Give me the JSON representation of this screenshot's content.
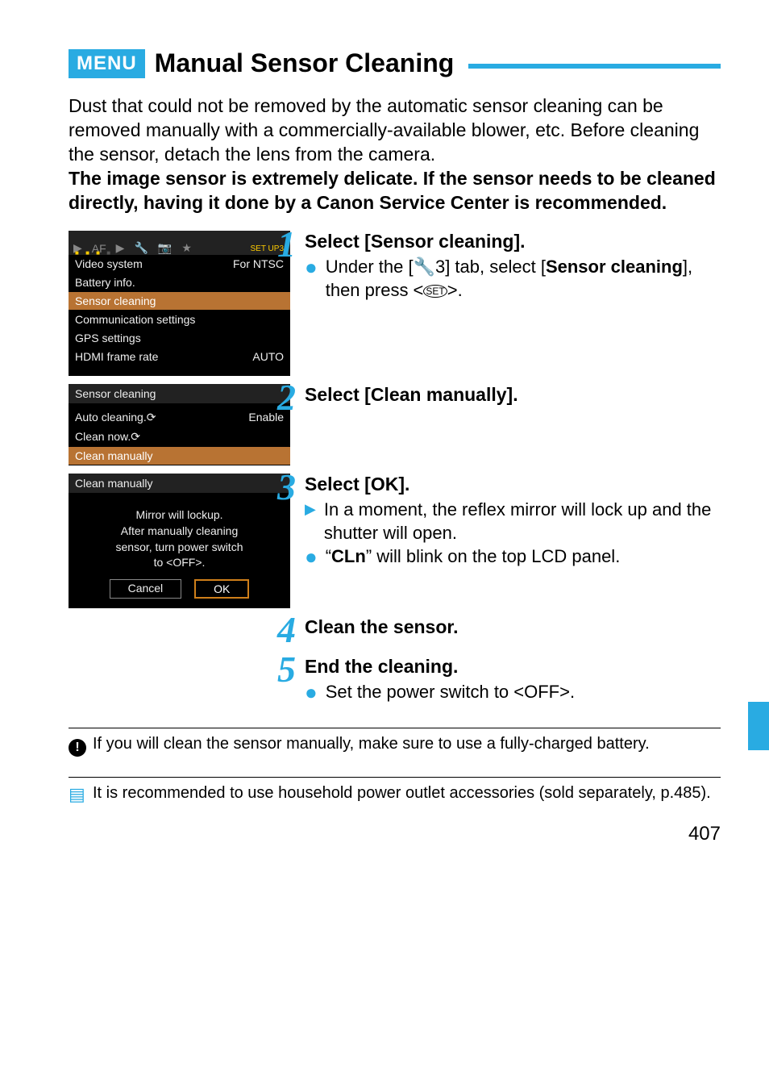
{
  "header": {
    "menu_badge": "MENU",
    "title": "Manual Sensor Cleaning"
  },
  "intro": {
    "p1": "Dust that could not be removed by the automatic sensor cleaning can be removed manually with a commercially-available blower, etc. Before cleaning the sensor, detach the lens from the camera.",
    "p2": "The image sensor is extremely delicate. If the sensor needs to be cleaned directly, having it done by a Canon Service Center is recommended."
  },
  "screens": {
    "setup": {
      "tab_label": "SET UP3",
      "items": [
        {
          "label": "Video system",
          "value": "For NTSC"
        },
        {
          "label": "Battery info.",
          "value": ""
        },
        {
          "label": "Sensor cleaning",
          "value": "",
          "hl": true
        },
        {
          "label": "Communication settings",
          "value": ""
        },
        {
          "label": "GPS settings",
          "value": ""
        },
        {
          "label": "HDMI frame rate",
          "value": "AUTO"
        }
      ]
    },
    "sensor_cleaning": {
      "title": "Sensor cleaning",
      "items": [
        {
          "label": "Auto cleaning",
          "value": "Enable"
        },
        {
          "label": "Clean now",
          "value": ""
        },
        {
          "label": "Clean manually",
          "value": "",
          "hl": true
        }
      ]
    },
    "clean_manually": {
      "title": "Clean manually",
      "body_l1": "Mirror will lockup.",
      "body_l2": "After manually cleaning",
      "body_l3": "sensor, turn power switch",
      "body_l4": "to <OFF>.",
      "cancel": "Cancel",
      "ok": "OK"
    }
  },
  "steps": {
    "s1": {
      "num": "1",
      "head": "Select [Sensor cleaning].",
      "b1a": "Under the [",
      "b1b": "3] tab, select [",
      "b1c": "Sensor cleaning",
      "b1d": "], then press <",
      "b1e": ">."
    },
    "s2": {
      "num": "2",
      "head": "Select [Clean manually]."
    },
    "s3": {
      "num": "3",
      "head": "Select [OK].",
      "b1": "In a moment, the reflex mirror will lock up and the shutter will open.",
      "b2a": "“",
      "b2b": "CLn",
      "b2c": "” will blink on the top LCD panel."
    },
    "s4": {
      "num": "4",
      "head": "Clean the sensor."
    },
    "s5": {
      "num": "5",
      "head": "End the cleaning.",
      "b1a": "Set the power switch to <",
      "b1b": "OFF",
      "b1c": ">."
    }
  },
  "notes": {
    "warn": "If you will clean the sensor manually, make sure to use a fully-charged battery.",
    "info": "It is recommended to use household power outlet accessories (sold separately, p.485)."
  },
  "page_number": "407",
  "icons": {
    "wrench": "🔧",
    "set": "SET"
  }
}
